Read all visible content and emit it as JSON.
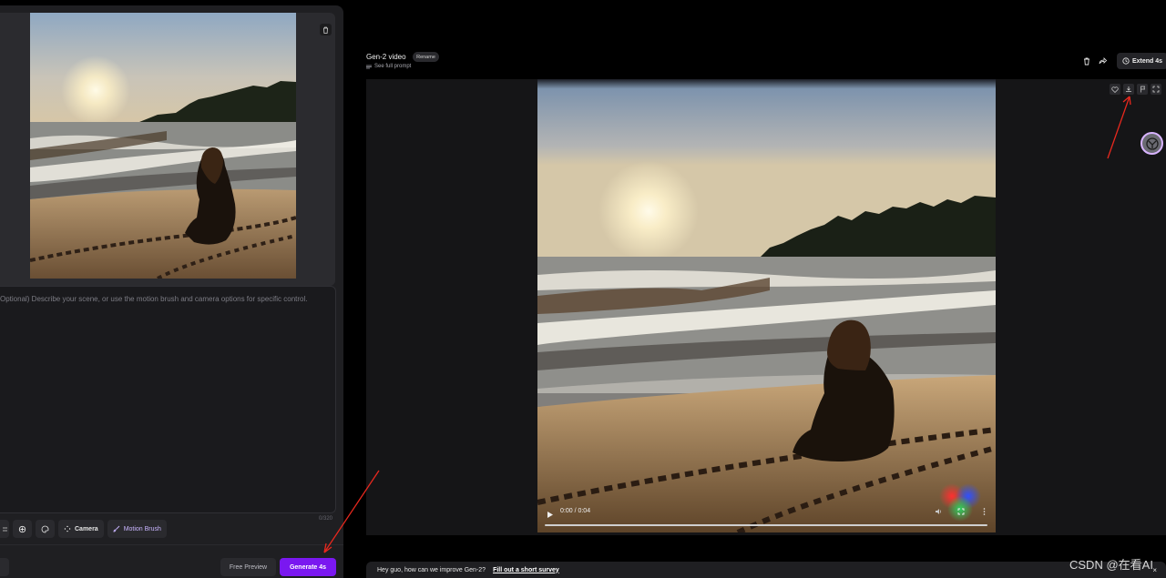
{
  "left_panel": {
    "prompt_placeholder": "Optional) Describe your scene, or use the motion brush and camera options for specific control.",
    "char_count": "0/320",
    "tools": {
      "camera_label": "Camera",
      "motion_brush_label": "Motion Brush"
    },
    "free_preview_label": "Free Preview",
    "generate_label": "Generate 4s"
  },
  "header": {
    "title": "Gen-2 video",
    "rename_label": "Rename",
    "see_prompt_label": "See full prompt",
    "extend_label": "Extend 4s"
  },
  "player": {
    "time": "0:00 / 0:04",
    "progress": 0
  },
  "survey": {
    "text": "Hey guo, how can we improve Gen-2?",
    "link": "Fill out a short survey",
    "close": "×"
  },
  "watermark": "CSDN @在看AI",
  "colors": {
    "accent": "#7a18f0",
    "annotation": "#e8281e"
  }
}
